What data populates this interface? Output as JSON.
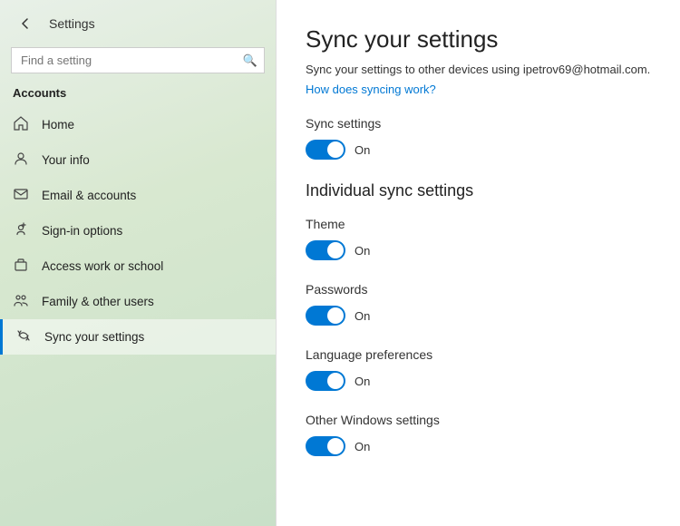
{
  "titlebar": {
    "app_title": "Settings"
  },
  "search": {
    "placeholder": "Find a setting"
  },
  "sidebar": {
    "section_label": "Accounts",
    "items": [
      {
        "id": "home",
        "label": "Home",
        "icon": "⌂"
      },
      {
        "id": "your-info",
        "label": "Your info",
        "icon": "👤"
      },
      {
        "id": "email-accounts",
        "label": "Email & accounts",
        "icon": "✉"
      },
      {
        "id": "sign-in-options",
        "label": "Sign-in options",
        "icon": "🔑"
      },
      {
        "id": "access-work",
        "label": "Access work or school",
        "icon": "💼"
      },
      {
        "id": "family",
        "label": "Family & other users",
        "icon": "👥"
      },
      {
        "id": "sync-settings",
        "label": "Sync your settings",
        "icon": "🔄"
      }
    ]
  },
  "main": {
    "page_title": "Sync your settings",
    "subtitle": "Sync your settings to other devices using ipetrov69@hotmail.com.",
    "link_text": "How does syncing work?",
    "sync_settings_label": "Sync settings",
    "sync_toggle_label": "On",
    "individual_title": "Individual sync settings",
    "individual_items": [
      {
        "id": "theme",
        "label": "Theme",
        "toggle_label": "On"
      },
      {
        "id": "passwords",
        "label": "Passwords",
        "toggle_label": "On"
      },
      {
        "id": "language",
        "label": "Language preferences",
        "toggle_label": "On"
      },
      {
        "id": "other-windows",
        "label": "Other Windows settings",
        "toggle_label": "On"
      }
    ]
  }
}
